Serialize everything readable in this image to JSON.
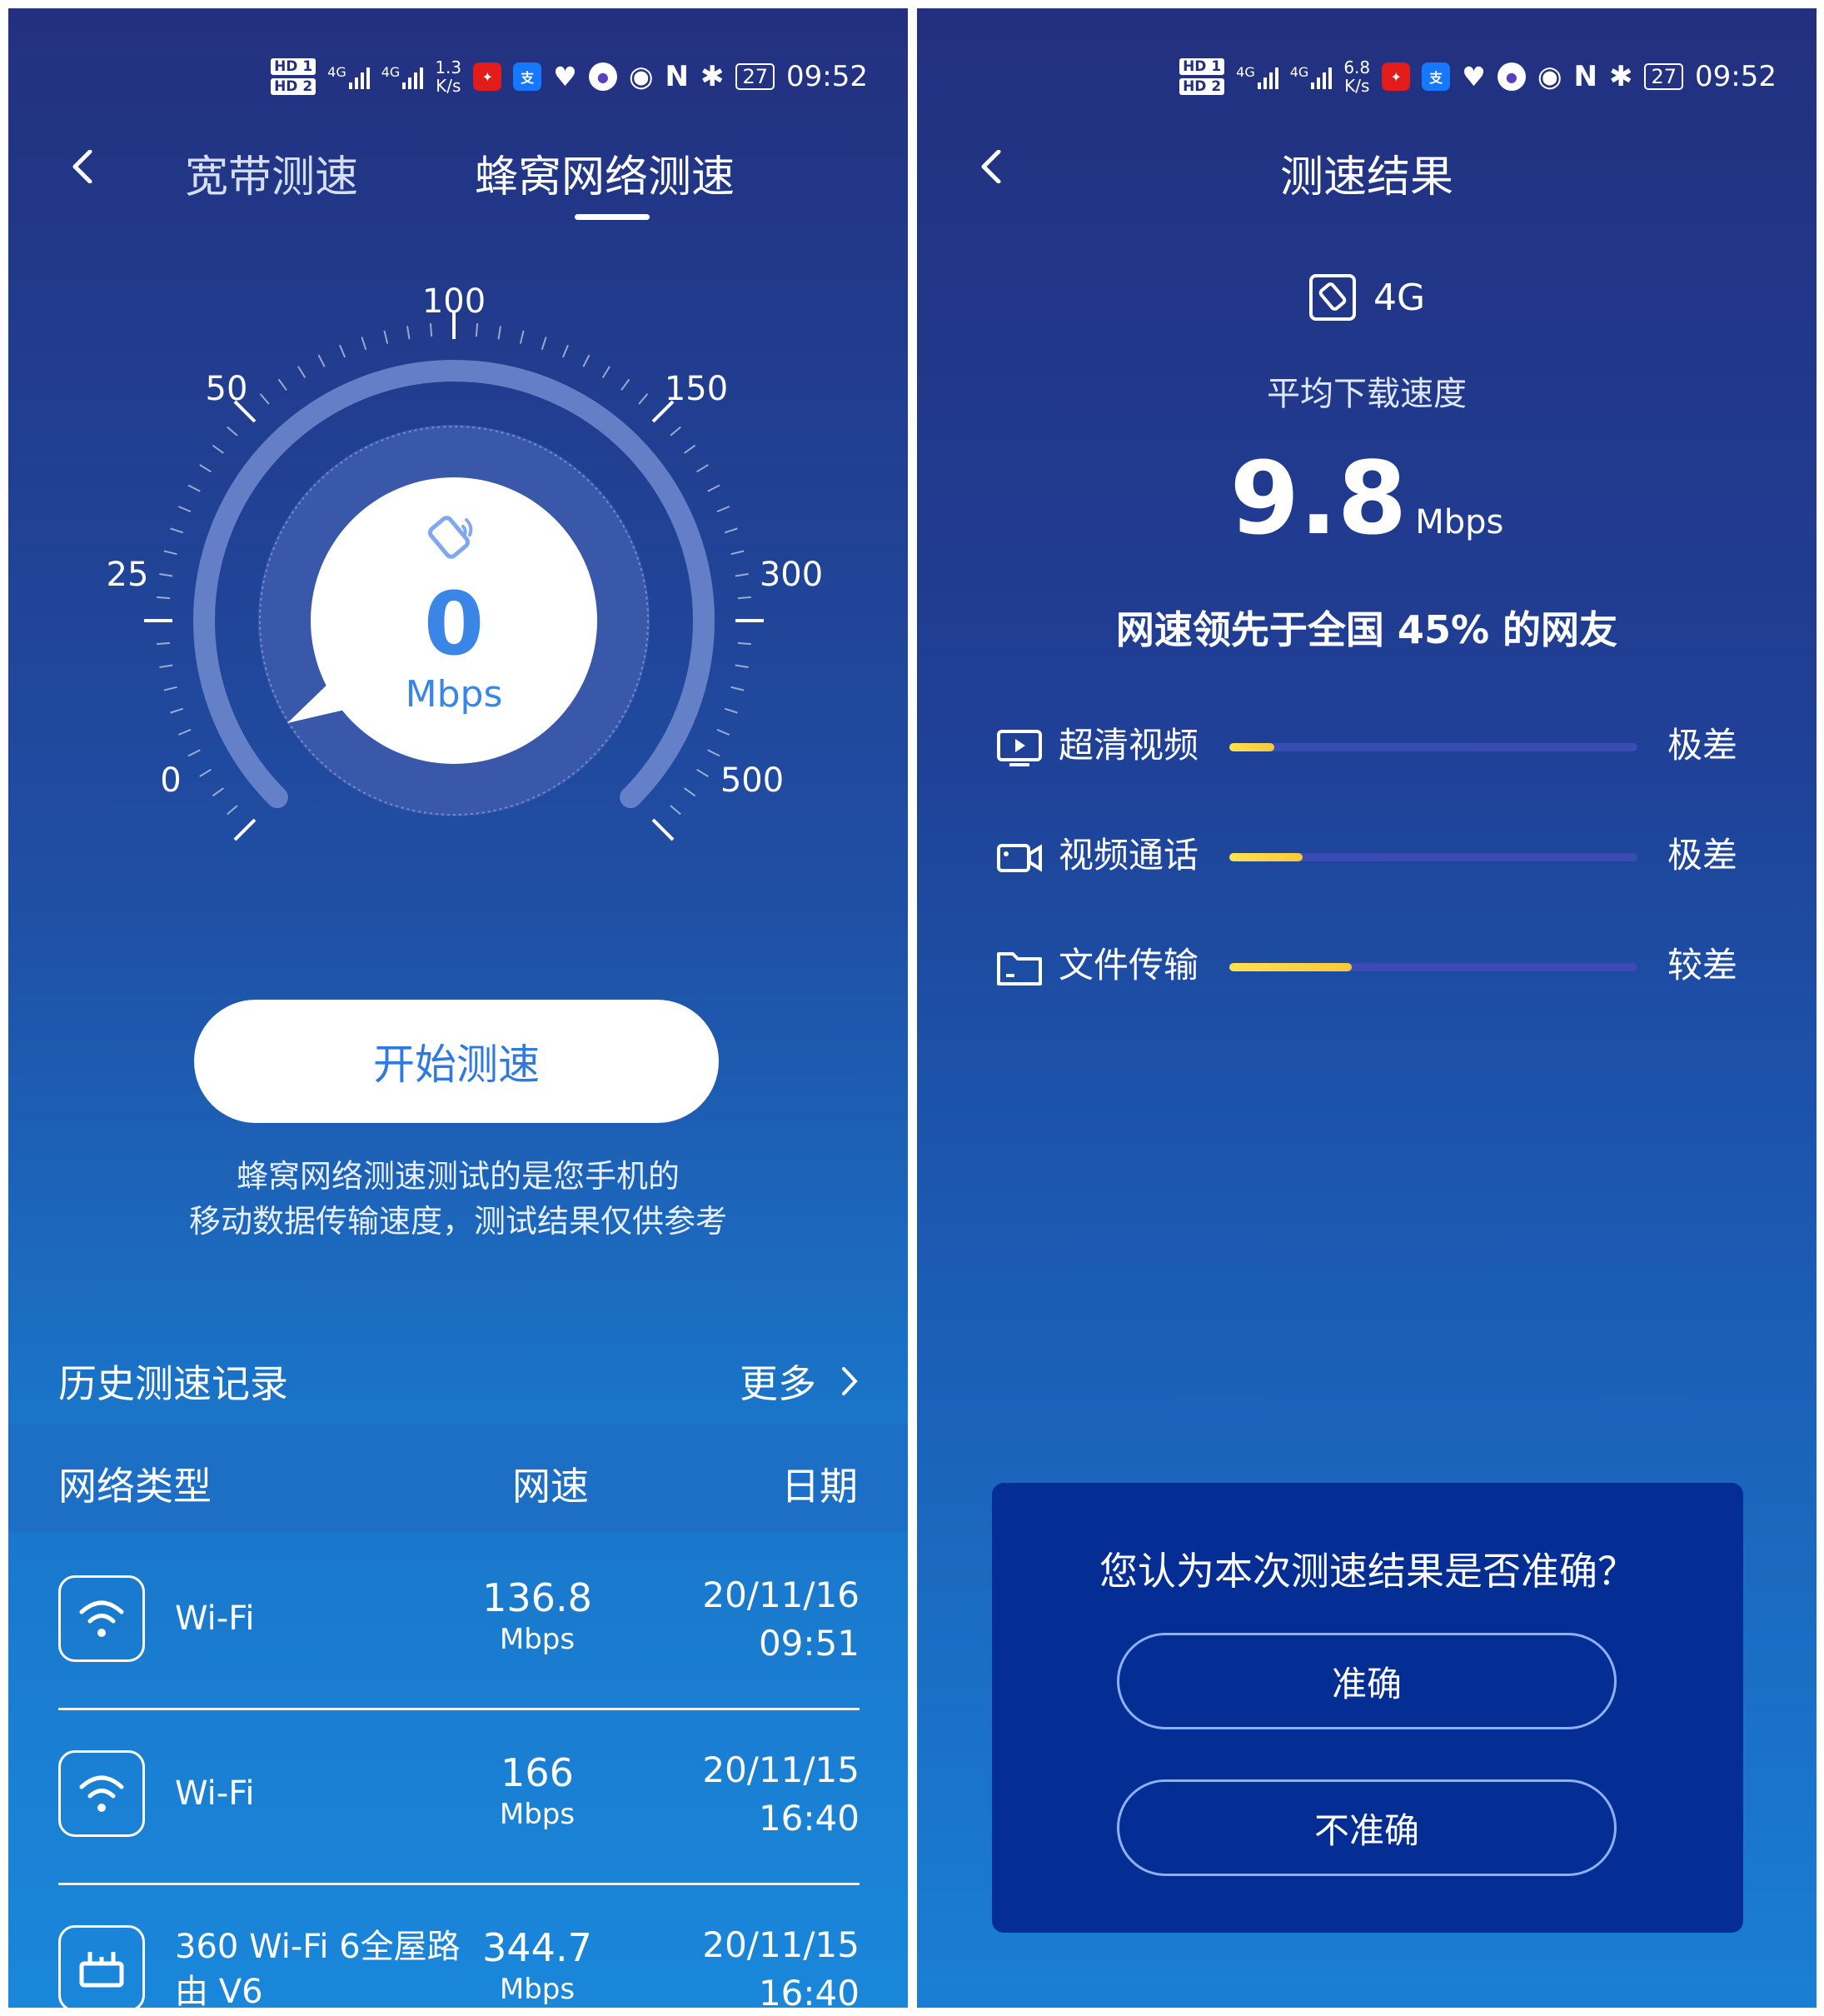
{
  "status_bar": {
    "hd1": "HD 1",
    "hd2": "HD 2",
    "net1": "4G",
    "net2": "4G",
    "rate_left": [
      "1.3",
      "K/s"
    ],
    "rate_right": [
      "6.8",
      "K/s"
    ],
    "battery": "27",
    "time": "09:52"
  },
  "left": {
    "tabs": [
      "宽带测速",
      "蜂窝网络测速"
    ],
    "active_tab": 1,
    "gauge": {
      "value": "0",
      "unit": "Mbps",
      "scale_labels": [
        "0",
        "25",
        "50",
        "100",
        "150",
        "300",
        "500"
      ]
    },
    "start_button": "开始测速",
    "hint_lines": [
      "蜂窝网络测速测试的是您手机的",
      "移动数据传输速度，测试结果仅供参考"
    ],
    "history": {
      "title": "历史测速记录",
      "more": "更多",
      "headers": [
        "网络类型",
        "网速",
        "日期"
      ],
      "rows": [
        {
          "icon": "wifi-icon",
          "name": [
            "Wi-Fi"
          ],
          "speed": "136.8",
          "unit": "Mbps",
          "date": "20/11/16",
          "time": "09:51"
        },
        {
          "icon": "wifi-icon",
          "name": [
            "Wi-Fi"
          ],
          "speed": "166",
          "unit": "Mbps",
          "date": "20/11/15",
          "time": "16:40"
        },
        {
          "icon": "router-icon",
          "name": [
            "360 Wi-Fi 6全屋路",
            "由 V6"
          ],
          "speed": "344.7",
          "unit": "Mbps",
          "date": "20/11/15",
          "time": "16:40"
        }
      ]
    }
  },
  "right": {
    "title": "测速结果",
    "network": "4G",
    "avg_label": "平均下载速度",
    "speed_value": "9.8",
    "speed_unit": "Mbps",
    "rank": "网速领先于全国 45% 的网友",
    "metrics": [
      {
        "icon": "tv-play-icon",
        "label": "超清视频",
        "rating": "极差",
        "level": 0.11
      },
      {
        "icon": "video-camera-icon",
        "label": "视频通话",
        "rating": "极差",
        "level": 0.18
      },
      {
        "icon": "folder-icon",
        "label": "文件传输",
        "rating": "较差",
        "level": 0.3
      }
    ],
    "feedback": {
      "question": "您认为本次测速结果是否准确？",
      "yes": "准确",
      "no": "不准确"
    }
  }
}
